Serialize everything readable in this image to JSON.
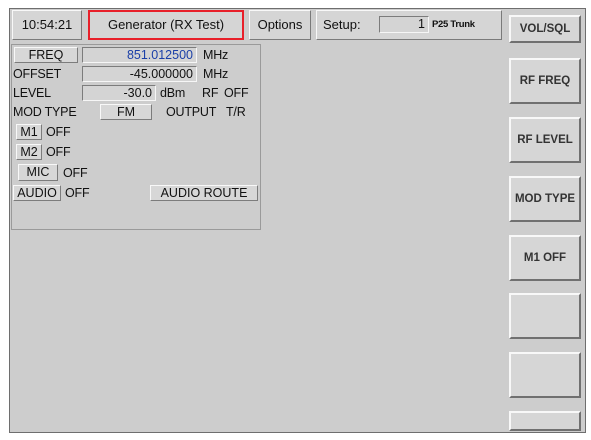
{
  "topbar": {
    "time": "10:54:21",
    "mode": "Generator (RX Test)",
    "options": "Options",
    "setup_label": "Setup:",
    "setup_value": "1",
    "setup_name": "P25 Trunk"
  },
  "panel": {
    "freq_label": "FREQ",
    "freq_value": "851.012500",
    "freq_unit": "MHz",
    "offset_label": "OFFSET",
    "offset_value": "-45.000000",
    "offset_unit": "MHz",
    "level_label": "LEVEL",
    "level_value": "-30.0",
    "level_unit": "dBm",
    "rf_label": "RF",
    "rf_value": "OFF",
    "modtype_label": "MOD TYPE",
    "modtype_value": "FM",
    "output_label": "OUTPUT",
    "output_value": "T/R",
    "m1_label": "M1",
    "m1_value": "OFF",
    "m2_label": "M2",
    "m2_value": "OFF",
    "mic_label": "MIC",
    "mic_value": "OFF",
    "audio_label": "AUDIO",
    "audio_value": "OFF",
    "audio_route": "AUDIO ROUTE"
  },
  "softkeys": {
    "vol_sql": "VOL/SQL",
    "rf_freq": "RF FREQ",
    "rf_level": "RF LEVEL",
    "mod_type": "MOD TYPE",
    "m1_off": "M1 OFF"
  },
  "colors": {
    "active_tab_border": "#e8202a",
    "freq_text": "#1a3fa8"
  }
}
